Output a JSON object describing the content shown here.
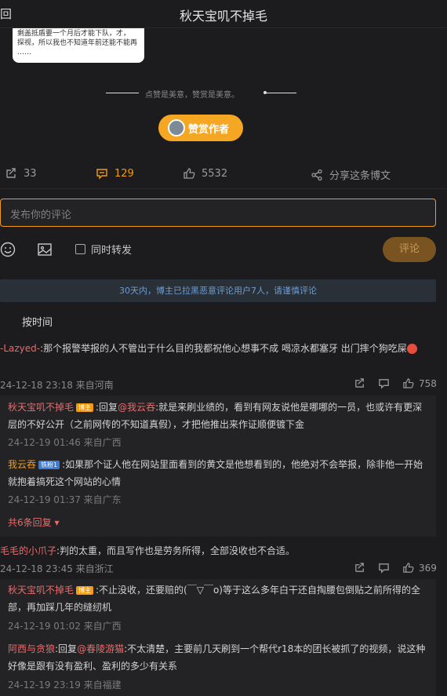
{
  "header": {
    "back_label": "回",
    "title": "秋天宝叽不掉毛"
  },
  "image_card": {
    "text": "  剩盖抵盾要一个月后才能下队，才，\n探视，所以我也不知道年前还能不能再\n……"
  },
  "reward": {
    "slogan": "点赞是美意，赞赏是美意。",
    "button_label": "赞赏作者"
  },
  "actions": {
    "repost_count": "33",
    "comment_count": "129",
    "like_count": "5532",
    "share_label": "分享这条博文"
  },
  "comment_box": {
    "placeholder": "发布你的评论",
    "repost_label": "同时转发",
    "submit_label": "评论"
  },
  "notice": "30天内，博主已拉黑恶意评论用户7人，请谨慎评论",
  "sort_label": "按时间",
  "comments": [
    {
      "user": "-Lazyed-",
      "text": ":那个报警举报的人不管出于什么目的我都祝他心想事不成 喝凉水都塞牙 出门摔个狗吃屎",
      "meta": "24-12-18 23:18 来自河南",
      "likes": "758",
      "replies": [
        {
          "user": "秋天宝叽不掉毛",
          "badge": "博主",
          "text": ":回复@我云吞:就是来刷业绩的，看到有网友说他是哪哪的一员，也或许有更深层的不好公开（之前网传的不知道真假），才把他推出来作证顺便镀下金",
          "mention": "@我云吞",
          "meta": "24-12-19 01:46 来自广西"
        },
        {
          "user": "我云吞",
          "badge": "铁粉1",
          "text": ":如果那个证人他在网站里面看到的黄文是他想看到的，他绝对不会举报，除非他一开始就抱着搞死这个网站的心情",
          "meta": "24-12-19 01:37 来自广东"
        }
      ],
      "more_label": "共6条回复"
    },
    {
      "user": "毛毛的小爪子",
      "text": ":判的太重，而且写作也是劳务所得，全部没收也不合适。",
      "meta": "24-12-18 23:45 来自浙江",
      "likes": "369",
      "replies": [
        {
          "user": "秋天宝叽不掉毛",
          "badge": "博主",
          "text": ":不止没收，还要赔的(￣▽￣o)等于这么多年白干还自掏腰包倒贴之前所得的全部，再加踩几年的缝纫机",
          "meta": "24-12-19 01:02 来自广西"
        },
        {
          "user": "阿西与贪狼",
          "text": ":回复@春陵游猫:不太清楚，主要前几天刷到一个帮代r18本的团长被抓了的视频，说这种好像是跟有没有盈利、盈利的多少有关系",
          "mention": "@春陵游猫",
          "meta": "24-12-19 23:19 来自福建"
        }
      ]
    }
  ],
  "colors": {
    "accent": "#f39c12",
    "username": "#e86c6c",
    "notice_text": "#6f9ccf",
    "background": "#1c1c1e"
  }
}
